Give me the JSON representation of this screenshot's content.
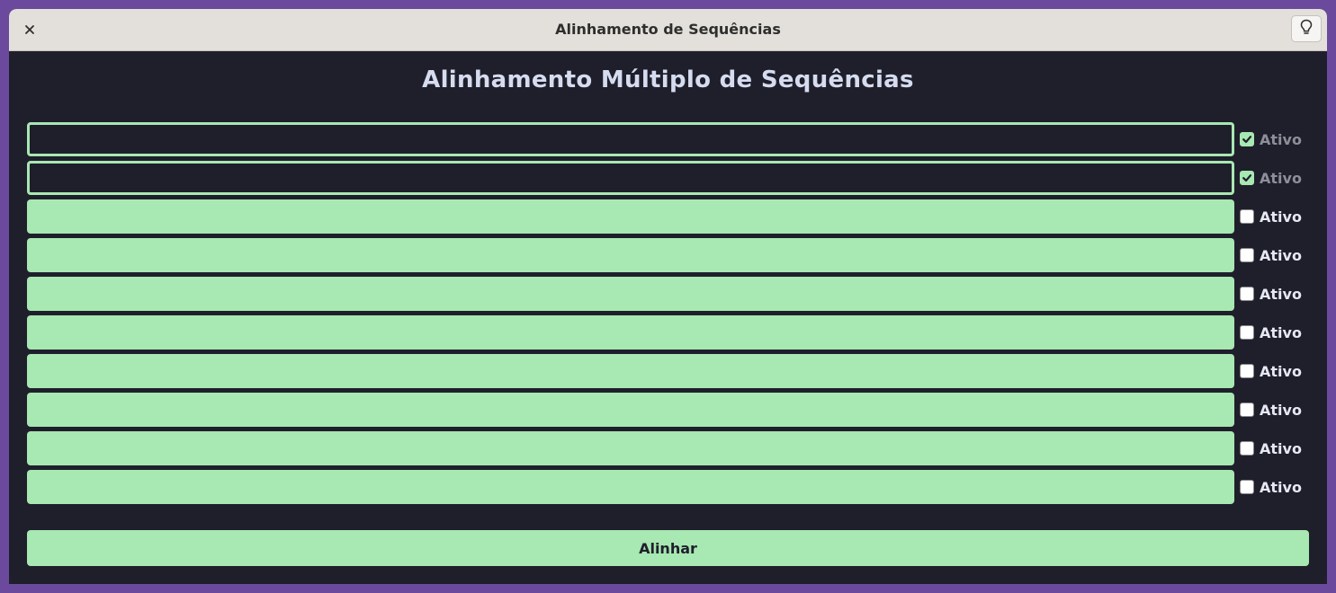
{
  "window": {
    "title": "Alinhamento de Sequências",
    "close_icon": "close-icon",
    "hint_icon": "lightbulb-icon"
  },
  "main": {
    "heading": "Alinhamento Múltiplo de Sequências",
    "sequences": [
      {
        "value": "",
        "active": true,
        "label": "Ativo"
      },
      {
        "value": "",
        "active": true,
        "label": "Ativo"
      },
      {
        "value": "",
        "active": false,
        "label": "Ativo"
      },
      {
        "value": "",
        "active": false,
        "label": "Ativo"
      },
      {
        "value": "",
        "active": false,
        "label": "Ativo"
      },
      {
        "value": "",
        "active": false,
        "label": "Ativo"
      },
      {
        "value": "",
        "active": false,
        "label": "Ativo"
      },
      {
        "value": "",
        "active": false,
        "label": "Ativo"
      },
      {
        "value": "",
        "active": false,
        "label": "Ativo"
      },
      {
        "value": "",
        "active": false,
        "label": "Ativo"
      }
    ],
    "align_button": "Alinhar"
  },
  "colors": {
    "background": "#1f1f2c",
    "accent": "#a8e8b2",
    "frame": "#6b4a9e",
    "titlebar": "#e3e0db"
  }
}
